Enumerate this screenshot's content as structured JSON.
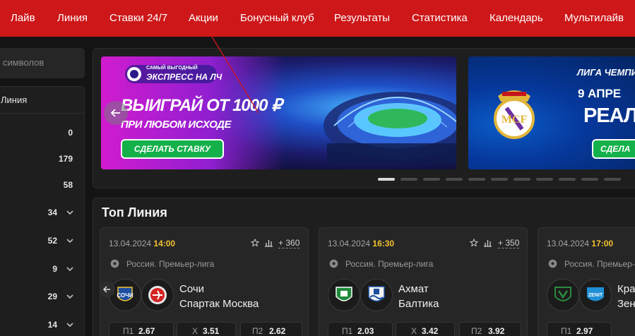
{
  "nav": {
    "items": [
      "Лайв",
      "Линия",
      "Ставки 24/7",
      "Акции",
      "Бонусный клуб",
      "Результаты",
      "Статистика",
      "Календарь",
      "Мультилайв"
    ]
  },
  "sidebar": {
    "search_placeholder": "символов",
    "header": "Линия",
    "counts": [
      "0",
      "179",
      "58",
      "34",
      "52",
      "9",
      "29",
      "14"
    ]
  },
  "banner1": {
    "badge_small": "САМЫЙ ВЫГОДНЫЙ",
    "badge_main": "ЭКСПРЕСС НА ЛЧ",
    "headline": "ВЫИГРАЙ ОТ 1000 ₽",
    "subline": "ПРИ ЛЮБОМ ИСХОДЕ",
    "button": "СДЕЛАТЬ СТАВКУ"
  },
  "banner2": {
    "line1": "ЛИГА ЧЕМПИО",
    "line2": "9 АПРЕ",
    "line3": "РЕАЛ –",
    "button": "СДЕЛА"
  },
  "topline": {
    "title": "Топ Линия",
    "cards": [
      {
        "date": "13.04.2024",
        "time": "14:00",
        "more": "+ 360",
        "league": "Россия. Премьер-лига",
        "team1": "Сочи",
        "team2": "Спартак Москва",
        "odds": [
          {
            "label": "П1",
            "value": "2.67"
          },
          {
            "label": "Х",
            "value": "3.51"
          },
          {
            "label": "П2",
            "value": "2.62"
          }
        ]
      },
      {
        "date": "13.04.2024",
        "time": "16:30",
        "more": "+ 350",
        "league": "Россия. Премьер-лига",
        "team1": "Ахмат",
        "team2": "Балтика",
        "odds": [
          {
            "label": "П1",
            "value": "2.03"
          },
          {
            "label": "Х",
            "value": "3.42"
          },
          {
            "label": "П2",
            "value": "3.92"
          }
        ]
      },
      {
        "date": "13.04.2024",
        "time": "17:00",
        "more": "",
        "league": "Россия. Премьер-лига",
        "team1": "Кра",
        "team2": "Зен",
        "odds": [
          {
            "label": "П1",
            "value": "2.97"
          },
          {
            "label": "",
            "value": ""
          },
          {
            "label": "",
            "value": ""
          }
        ]
      }
    ]
  },
  "colors": {
    "nav_bg": "#cd1719",
    "accent_time": "#f2c230",
    "cta_green": "#14b04a",
    "bg": "#141414"
  }
}
